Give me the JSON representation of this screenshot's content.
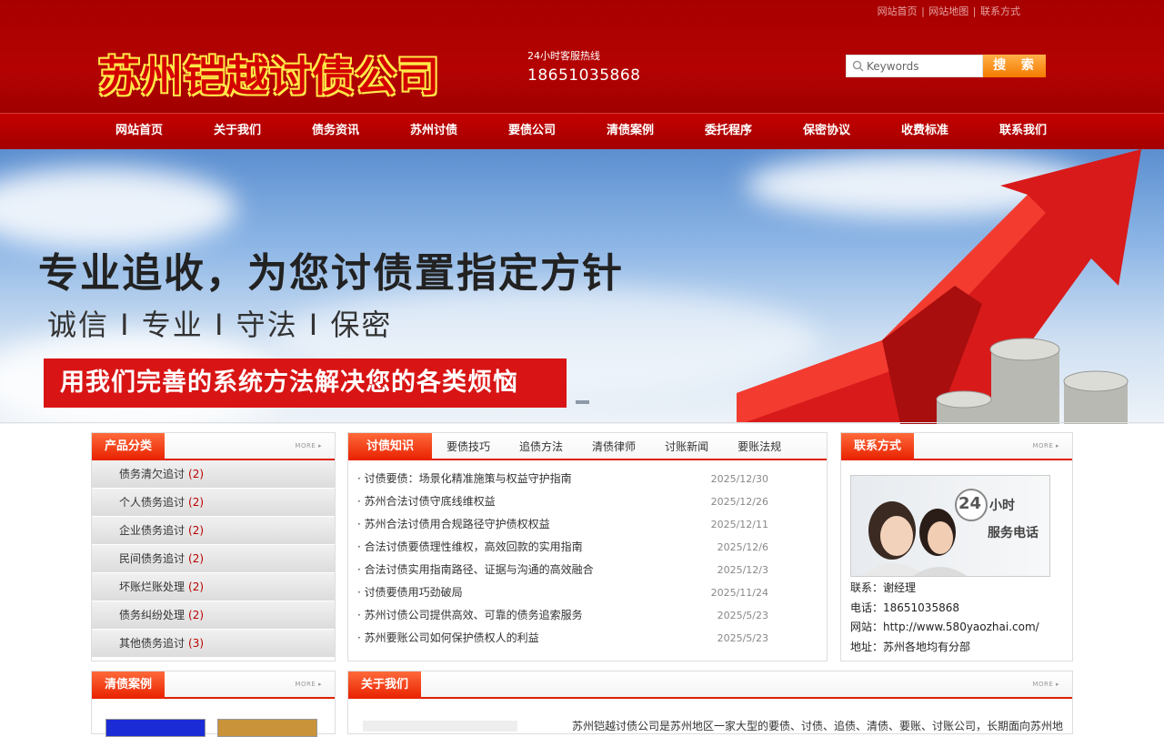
{
  "top_links": [
    "网站首页",
    "网站地图",
    "联系方式"
  ],
  "logo_text": "苏州铠越讨债公司",
  "hotline": {
    "label": "24小时客服热线",
    "number": "18651035868"
  },
  "search": {
    "placeholder": "Keywords",
    "button": "搜 索"
  },
  "nav": [
    "网站首页",
    "关于我们",
    "债务资讯",
    "苏州讨债",
    "要债公司",
    "清债案例",
    "委托程序",
    "保密协议",
    "收费标准",
    "联系我们"
  ],
  "banner": {
    "title": "专业追收，为您讨债置指定方针",
    "subtitle": "诚信 I 专业 I 守法 I 保密",
    "bar": "用我们完善的系统方法解决您的各类烦恼"
  },
  "product_panel": {
    "title": "产品分类",
    "more": "MORE ▸",
    "items": [
      {
        "label": "债务清欠追讨",
        "count": "(2)"
      },
      {
        "label": "个人债务追讨",
        "count": "(2)"
      },
      {
        "label": "企业债务追讨",
        "count": "(2)"
      },
      {
        "label": "民间债务追讨",
        "count": "(2)"
      },
      {
        "label": "坏账烂账处理",
        "count": "(2)"
      },
      {
        "label": "债务纠纷处理",
        "count": "(2)"
      },
      {
        "label": "其他债务追讨",
        "count": "(3)"
      }
    ]
  },
  "news_panel": {
    "tabs": [
      "讨债知识",
      "要债技巧",
      "追债方法",
      "清债律师",
      "讨账新闻",
      "要账法规"
    ],
    "items": [
      {
        "title": "· 讨债要债：场景化精准施策与权益守护指南",
        "date": "2025/12/30"
      },
      {
        "title": "· 苏州合法讨债守底线维权益",
        "date": "2025/12/26"
      },
      {
        "title": "· 苏州合法讨债用合规路径守护债权权益",
        "date": "2025/12/11"
      },
      {
        "title": "· 合法讨债要债理性维权，高效回款的实用指南",
        "date": "2025/12/6"
      },
      {
        "title": "· 合法讨债实用指南路径、证据与沟通的高效融合",
        "date": "2025/12/3"
      },
      {
        "title": "· 讨债要债用巧劲破局",
        "date": "2025/11/24"
      },
      {
        "title": "· 苏州讨债公司提供高效、可靠的债务追索服务",
        "date": "2025/5/23"
      },
      {
        "title": "· 苏州要账公司如何保护债权人的利益",
        "date": "2025/5/23"
      }
    ]
  },
  "contact_panel": {
    "title": "联系方式",
    "more": "MORE ▸",
    "photo_text": {
      "badge": "24",
      "line1": "小时",
      "line2": "服务电话"
    },
    "lines": [
      "联系：谢经理",
      "电话：18651035868",
      "网站：http://www.580yaozhai.com/",
      "地址：苏州各地均有分部"
    ]
  },
  "cases_panel": {
    "title": "清债案例",
    "more": "MORE ▸"
  },
  "about_panel": {
    "title": "关于我们",
    "more": "MORE ▸",
    "text": "苏州铠越讨债公司是苏州地区一家大型的要债、讨债、追债、清债、要账、讨账公司，长期面向苏州地"
  },
  "colors": {
    "header_red": "#a80000",
    "accent": "#e82000",
    "search_btn": "#f47a00",
    "logo_outline": "#ffe94a"
  }
}
